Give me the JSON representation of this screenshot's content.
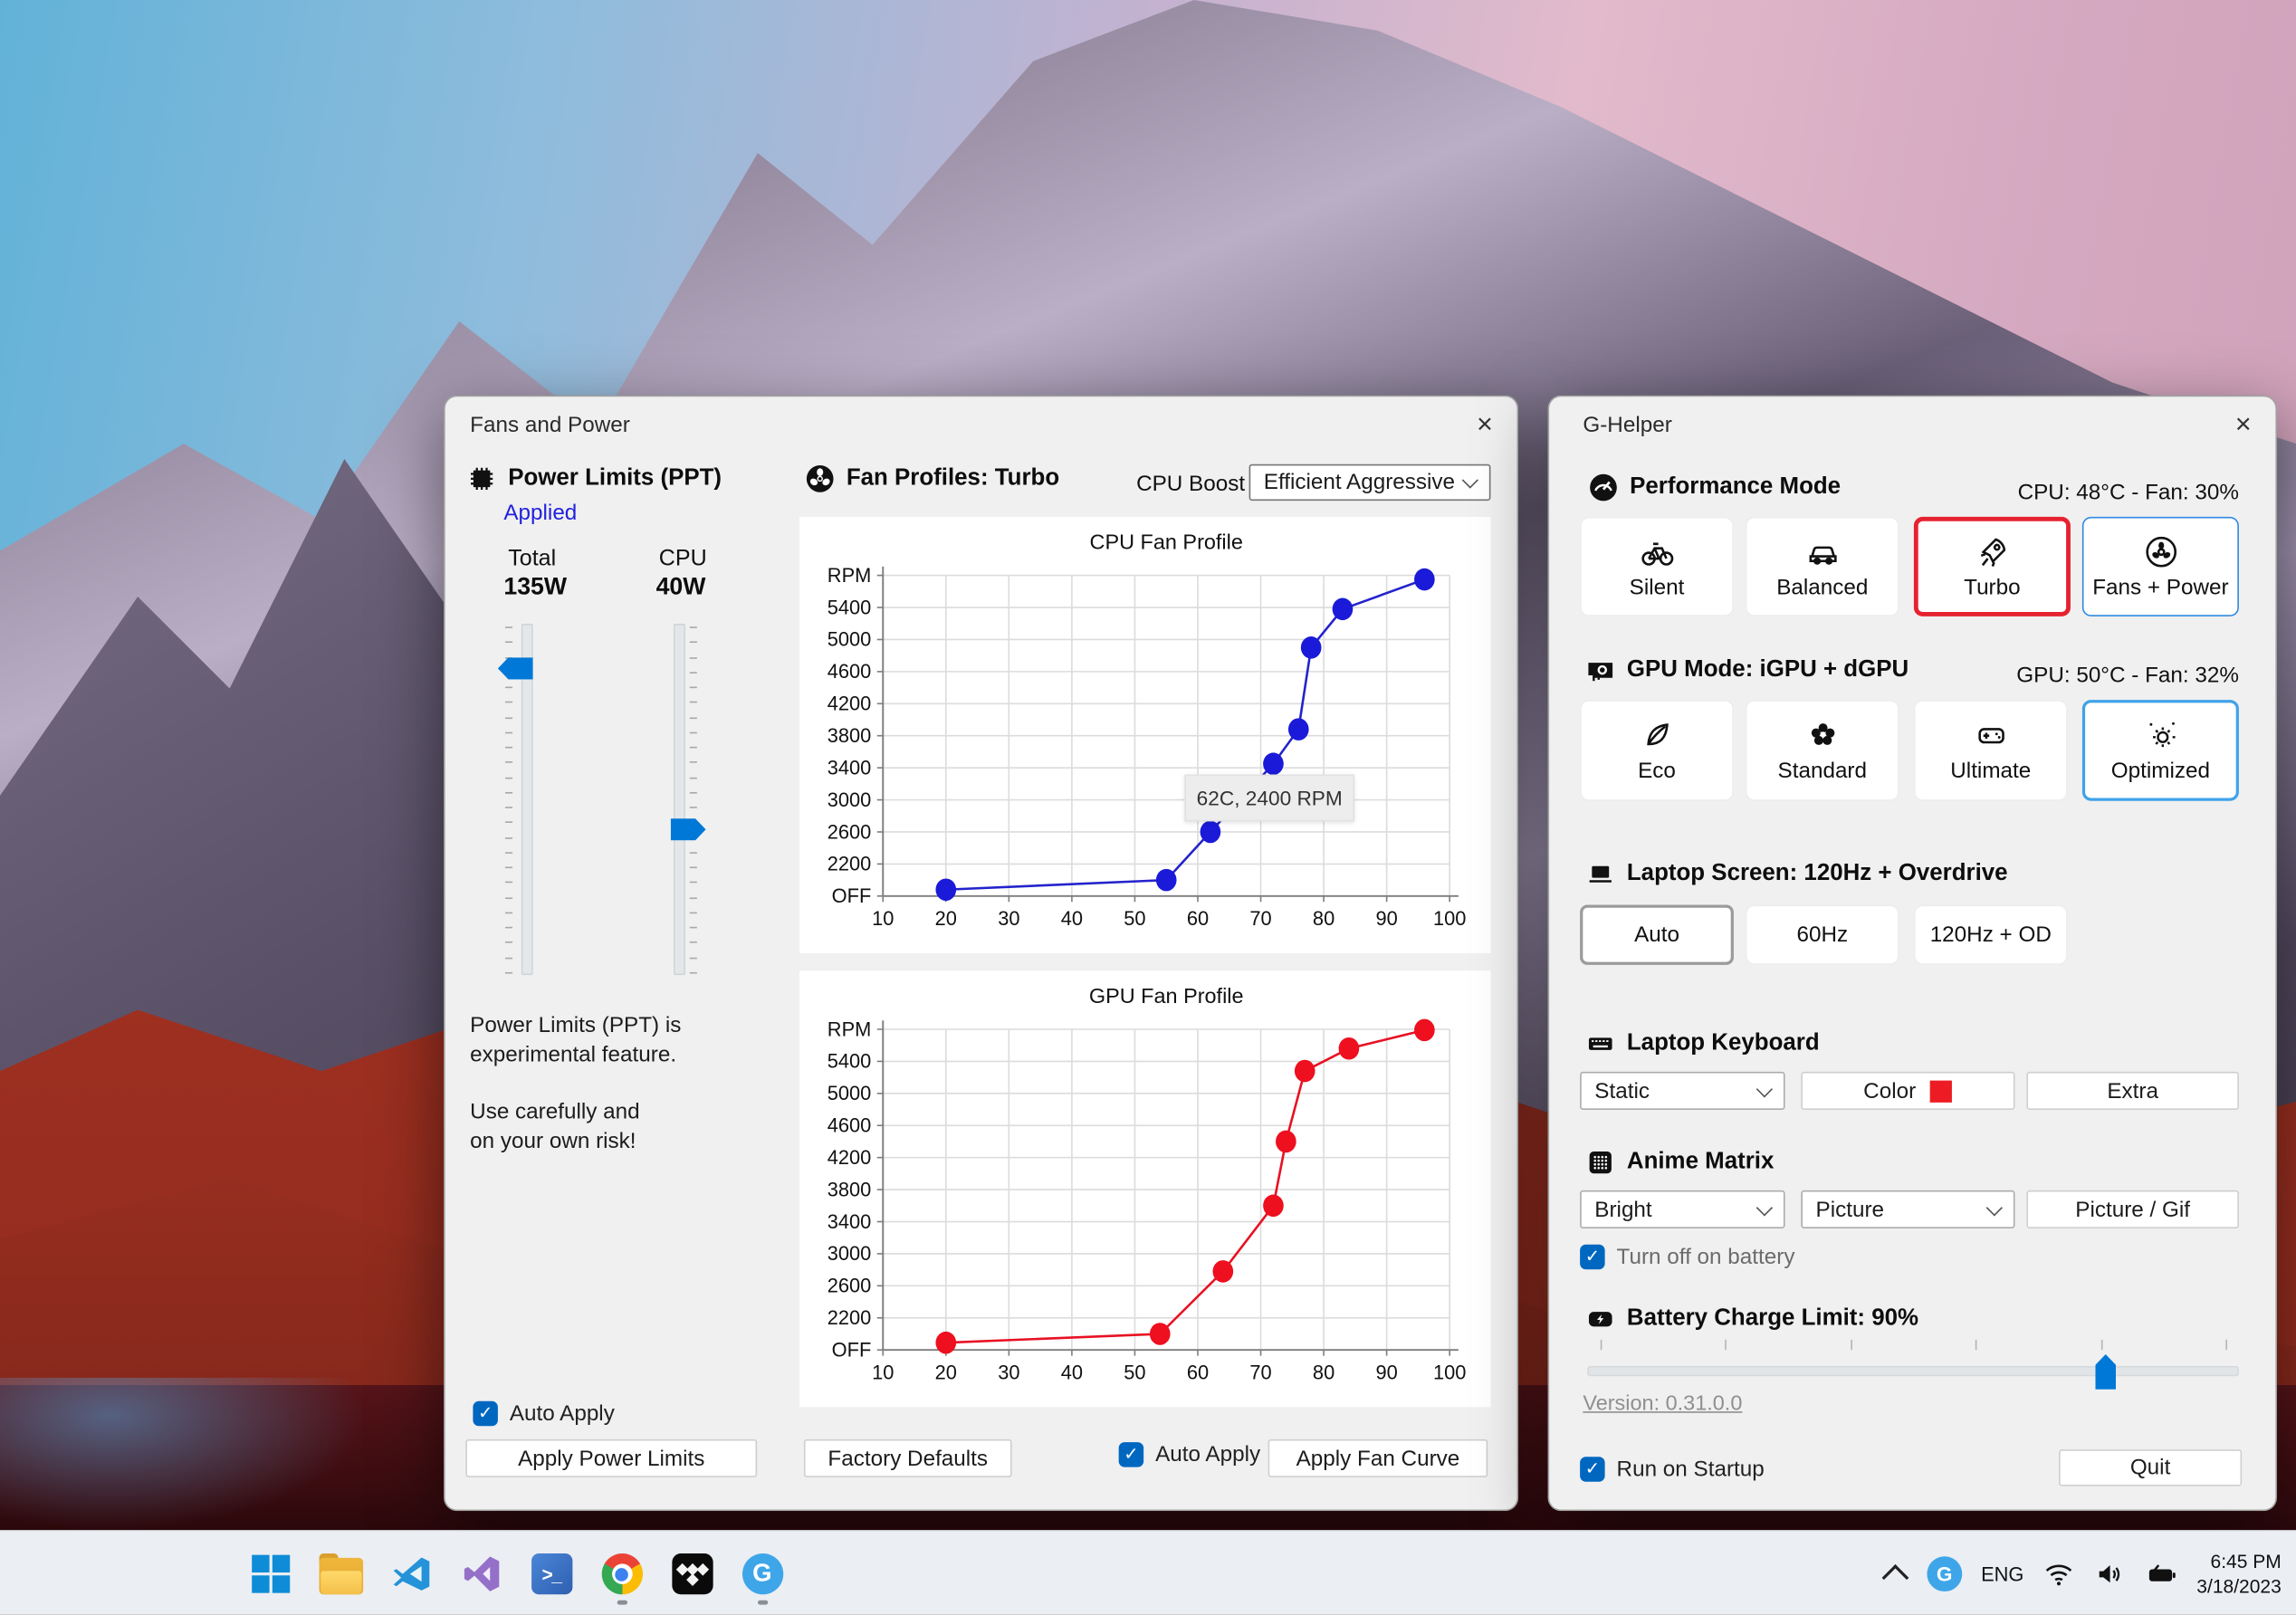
{
  "taskbar": {
    "icons": [
      {
        "name": "start"
      },
      {
        "name": "file-explorer"
      },
      {
        "name": "vscode"
      },
      {
        "name": "visual-studio"
      },
      {
        "name": "powershell",
        "glyph": ">_"
      },
      {
        "name": "chrome",
        "active": true
      },
      {
        "name": "media-app"
      },
      {
        "name": "g-helper",
        "glyph": "G",
        "active": true
      }
    ],
    "tray": {
      "language": "ENG",
      "ghelper_glyph": "G",
      "time": "6:45 PM",
      "date": "3/18/2023"
    }
  },
  "fans_window": {
    "title": "Fans and Power",
    "close": "×",
    "power_limits": {
      "header": "Power Limits (PPT)",
      "status": "Applied",
      "total_label": "Total",
      "total_value": "135W",
      "cpu_label": "CPU",
      "cpu_value": "40W",
      "warning_line1": "Power Limits (PPT) is",
      "warning_line2": "experimental feature.",
      "warning_line3": "Use carefully and",
      "warning_line4": "on your own risk!",
      "auto_apply_label": "Auto Apply",
      "apply_button": "Apply Power Limits"
    },
    "fan_profiles": {
      "header": "Fan Profiles: Turbo",
      "cpu_boost_label": "CPU Boost",
      "cpu_boost_value": "Efficient Aggressive",
      "tooltip": "62C, 2400 RPM",
      "factory_defaults_button": "Factory Defaults",
      "auto_apply_label": "Auto Apply",
      "apply_fan_curve_button": "Apply Fan Curve"
    }
  },
  "chart_data": [
    {
      "type": "line",
      "title": "CPU Fan Profile",
      "color": "#2323cc",
      "point_color": "#1a1ad8",
      "x": [
        20,
        55,
        62,
        72,
        76,
        78,
        83,
        96
      ],
      "y": [
        1880,
        2000,
        2600,
        3450,
        3880,
        4900,
        5380,
        5750
      ],
      "xlim": [
        10,
        100
      ],
      "ylim": [
        1800,
        5800
      ],
      "x_ticks": [
        10,
        20,
        30,
        40,
        50,
        60,
        70,
        80,
        90,
        100
      ],
      "y_tick_values": [
        1800,
        2200,
        2600,
        3000,
        3400,
        3800,
        4200,
        4600,
        5000,
        5400,
        5800
      ],
      "y_tick_labels": [
        "OFF",
        "2200",
        "2600",
        "3000",
        "3400",
        "3800",
        "4200",
        "4600",
        "5000",
        "5400",
        "RPM"
      ],
      "grid": true,
      "legend": "none"
    },
    {
      "type": "line",
      "title": "GPU Fan Profile",
      "color": "#e81123",
      "point_color": "#ee0f1f",
      "x": [
        20,
        54,
        64,
        72,
        74,
        77,
        84,
        96
      ],
      "y": [
        1890,
        2000,
        2780,
        3600,
        4400,
        5280,
        5560,
        5790
      ],
      "xlim": [
        10,
        100
      ],
      "ylim": [
        1800,
        5800
      ],
      "x_ticks": [
        10,
        20,
        30,
        40,
        50,
        60,
        70,
        80,
        90,
        100
      ],
      "y_tick_values": [
        1800,
        2200,
        2600,
        3000,
        3400,
        3800,
        4200,
        4600,
        5000,
        5400,
        5800
      ],
      "y_tick_labels": [
        "OFF",
        "2200",
        "2600",
        "3000",
        "3400",
        "3800",
        "4200",
        "4600",
        "5000",
        "5400",
        "RPM"
      ],
      "grid": true,
      "legend": "none"
    }
  ],
  "ghelper_window": {
    "title": "G-Helper",
    "close": "×",
    "performance": {
      "header": "Performance Mode",
      "status": "CPU: 48°C -  Fan: 30%",
      "buttons": [
        {
          "label": "Silent",
          "icon": "bicycle",
          "selected": false
        },
        {
          "label": "Balanced",
          "icon": "car",
          "selected": false
        },
        {
          "label": "Turbo",
          "icon": "rocket",
          "selected": true
        },
        {
          "label": "Fans + Power",
          "icon": "fan",
          "selected": false
        }
      ]
    },
    "gpu": {
      "header": "GPU Mode: iGPU + dGPU",
      "status": "GPU: 50°C -  Fan: 32%",
      "buttons": [
        {
          "label": "Eco",
          "icon": "leaf",
          "selected": false
        },
        {
          "label": "Standard",
          "icon": "flower",
          "selected": false
        },
        {
          "label": "Ultimate",
          "icon": "gamepad",
          "selected": false
        },
        {
          "label": "Optimized",
          "icon": "auto-optimize",
          "selected": true
        }
      ]
    },
    "screen": {
      "header": "Laptop Screen: 120Hz + Overdrive",
      "buttons": [
        {
          "label": "Auto",
          "selected": true
        },
        {
          "label": "60Hz",
          "selected": false
        },
        {
          "label": "120Hz + OD",
          "selected": false
        }
      ]
    },
    "keyboard": {
      "header": "Laptop Keyboard",
      "mode_value": "Static",
      "color_button": "Color",
      "color_swatch": "#ed1c24",
      "extra_button": "Extra"
    },
    "matrix": {
      "header": "Anime Matrix",
      "brightness_value": "Bright",
      "content_value": "Picture",
      "picture_button": "Picture / Gif",
      "battery_checkbox": "Turn off on battery"
    },
    "battery": {
      "header": "Battery Charge Limit: 90%",
      "percent": 90
    },
    "version": "Version: 0.31.0.0",
    "startup_checkbox": "Run on Startup",
    "quit_button": "Quit"
  },
  "colors": {
    "accent_blue": "#0078d7",
    "selected_red": "#e62230",
    "selected_blue": "#3fa3e8",
    "checkbox_blue": "#0067c0",
    "link_blue": "#2222dd"
  }
}
